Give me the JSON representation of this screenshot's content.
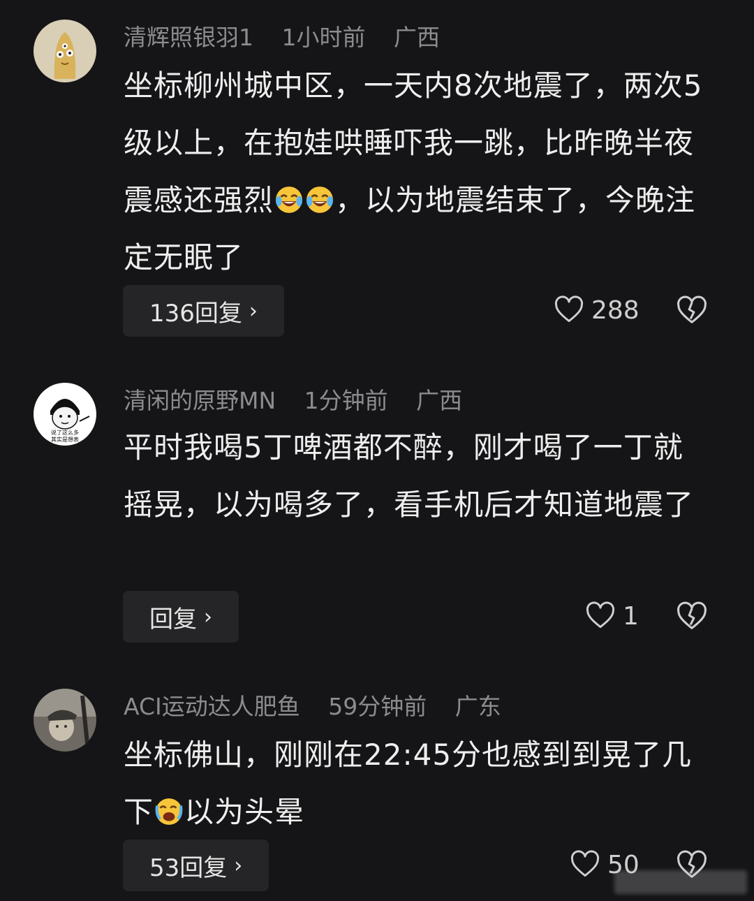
{
  "comments": [
    {
      "username": "清辉照银羽1",
      "time": "1小时前",
      "location": "广西",
      "text_before_emoji": "坐标柳州城中区，一天内8次地震了，两次5级以上，在抱娃哄睡吓我一跳，比昨晚半夜震感还强烈",
      "emojis": [
        "laugh-cry-emoji",
        "laugh-cry-emoji"
      ],
      "text_after_emoji": "，以为地震结束了，今晚注定无眠了",
      "reply_label": "136回复",
      "likes": "288"
    },
    {
      "username": "清闲的原野MN",
      "time": "1分钟前",
      "location": "广西",
      "text": "平时我喝5丁啤酒都不醉，刚才喝了一丁就摇晃，以为喝多了，看手机后才知道地震了",
      "avatar_caption_1": "说了这么多",
      "avatar_caption_2": "其实是想表",
      "reply_label": "回复",
      "likes": "1"
    },
    {
      "username": "ACI运动达人肥鱼",
      "time": "59分钟前",
      "location": "广东",
      "text_before_emoji": "坐标佛山，刚刚在22:45分也感到到晃了几下",
      "emojis": [
        "crying-laugh-emoji"
      ],
      "text_after_emoji": "以为头晕",
      "reply_label": "53回复",
      "likes": "50"
    }
  ],
  "colors": {
    "background": "#151517",
    "meta_text": "#8c8c8f",
    "reply_button_bg": "#252527"
  },
  "icons": {
    "reply_chevron": "chevron-right-icon",
    "like": "heart-outline-icon",
    "dislike": "broken-heart-icon"
  }
}
